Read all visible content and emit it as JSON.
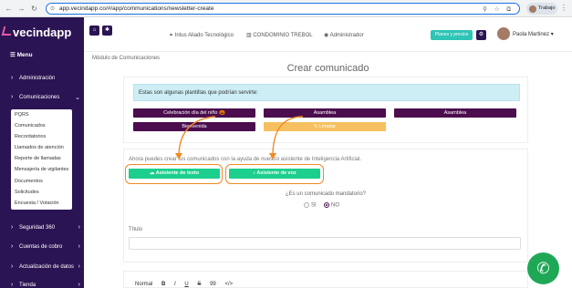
{
  "browser": {
    "url": "app.vecindapp.co/#/app/communications/newsletter-create",
    "profile": "Trabajo"
  },
  "sidebar": {
    "logo": "vecindapp",
    "menu_label": "Menu",
    "items": [
      {
        "label": "Administración"
      },
      {
        "label": "Comunicaciones"
      },
      {
        "label": "Seguridad 360"
      },
      {
        "label": "Cuentas de cobro"
      },
      {
        "label": "Actualización de datos"
      },
      {
        "label": "Tienda"
      }
    ],
    "submenu": [
      "PQRS",
      "Comunicados",
      "Recordatorios",
      "Llamados de atención",
      "Reporte de llamadas",
      "Mensajería de vigilantes",
      "Documentos",
      "Solicitudes",
      "Encuesta / Votación"
    ]
  },
  "topbar": {
    "company": "Intus Aliado Tecnológico",
    "condo": "CONDOMINIO TREBOL",
    "role": "Administrador",
    "plans_button": "Planes y precios",
    "user_name": "Paola Martinez"
  },
  "main": {
    "breadcrumb": "Módulo de Comunicaciones",
    "title": "Crear comunicado",
    "templates_info": "Estas son algunas plantillas que podrían servirte:",
    "templates": [
      "Celebración día del niño 🎃",
      "Asamblea",
      "Asamblea",
      "Bienvenida"
    ],
    "clear_button": "Limpiar",
    "ai_text": "Ahora puedes crear tus comunicados con la ayuda de nuestro asistente de Inteligencia Artificial.",
    "ai_text_button": "Asistente de texto",
    "ai_voice_button": "Asistente de voz",
    "mandatory_question": "¿Es un comunicado mandatorio?",
    "option_yes": "SI",
    "option_no": "NO",
    "title_label": "Título",
    "editor_style": "Normal",
    "editor_tools": [
      "B",
      "I",
      "U",
      "S",
      "99",
      "</>"
    ]
  }
}
